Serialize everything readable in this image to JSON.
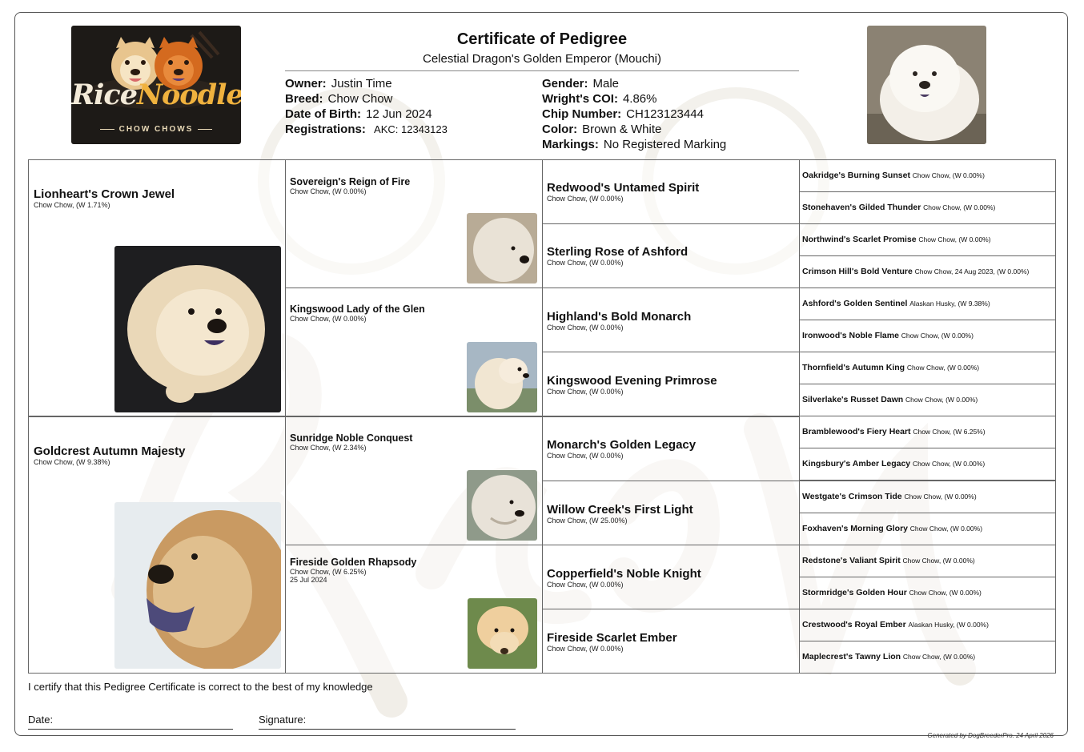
{
  "header": {
    "title": "Certificate of Pedigree",
    "subtitle": "Celestial Dragon's Golden Emperor (Mouchi)",
    "logo_word1": "Rice",
    "logo_word2": "Noodle",
    "logo_tagline": "CHOW CHOWS"
  },
  "info_left": [
    {
      "label": "Owner:",
      "value": "Justin Time"
    },
    {
      "label": "Breed:",
      "value": "Chow Chow"
    },
    {
      "label": "Date of Birth:",
      "value": "12 Jun 2024"
    },
    {
      "label": "Registrations:",
      "value": "AKC: 12343123"
    }
  ],
  "info_right": [
    {
      "label": "Gender:",
      "value": "Male"
    },
    {
      "label": "Wright's COI:",
      "value": "4.86%"
    },
    {
      "label": "Chip Number:",
      "value": "CH123123444"
    },
    {
      "label": "Color:",
      "value": "Brown & White"
    },
    {
      "label": "Markings:",
      "value": "No Registered Marking"
    }
  ],
  "gen1": [
    {
      "name": "Lionheart's Crown Jewel",
      "sub": "Chow Chow, (W 1.71%)"
    },
    {
      "name": "Goldcrest Autumn Majesty",
      "sub": "Chow Chow, (W 9.38%)"
    }
  ],
  "gen2": [
    {
      "name": "Sovereign's Reign of Fire",
      "sub": "Chow Chow, (W 0.00%)",
      "sub2": ""
    },
    {
      "name": "Kingswood Lady of the Glen",
      "sub": "Chow Chow, (W 0.00%)",
      "sub2": ""
    },
    {
      "name": "Sunridge Noble Conquest",
      "sub": "Chow Chow, (W 2.34%)",
      "sub2": ""
    },
    {
      "name": "Fireside Golden Rhapsody",
      "sub": "Chow Chow, (W 6.25%)",
      "sub2": "25 Jul 2024"
    }
  ],
  "gen3": [
    {
      "name": "Redwood's Untamed Spirit",
      "sub": "Chow Chow, (W 0.00%)"
    },
    {
      "name": "Sterling Rose of Ashford",
      "sub": "Chow Chow, (W 0.00%)"
    },
    {
      "name": "Highland's Bold Monarch",
      "sub": "Chow Chow, (W 0.00%)"
    },
    {
      "name": "Kingswood Evening Primrose",
      "sub": "Chow Chow, (W 0.00%)"
    },
    {
      "name": "Monarch's Golden Legacy",
      "sub": "Chow Chow, (W 0.00%)"
    },
    {
      "name": "Willow Creek's First Light",
      "sub": "Chow Chow, (W 25.00%)"
    },
    {
      "name": "Copperfield's Noble Knight",
      "sub": "Chow Chow, (W 0.00%)"
    },
    {
      "name": "Fireside Scarlet Ember",
      "sub": "Chow Chow, (W 0.00%)"
    }
  ],
  "gen4": [
    {
      "name": "Oakridge's Burning Sunset",
      "sub": "Chow Chow, (W 0.00%)"
    },
    {
      "name": "Stonehaven's Gilded Thunder",
      "sub": "Chow Chow, (W 0.00%)"
    },
    {
      "name": "Northwind's Scarlet Promise",
      "sub": "Chow Chow, (W 0.00%)"
    },
    {
      "name": "Crimson Hill's Bold Venture",
      "sub": "Chow Chow, 24 Aug 2023, (W 0.00%)"
    },
    {
      "name": "Ashford's Golden Sentinel",
      "sub": "Alaskan Husky, (W 9.38%)"
    },
    {
      "name": "Ironwood's Noble Flame",
      "sub": "Chow Chow, (W 0.00%)"
    },
    {
      "name": "Thornfield's Autumn King",
      "sub": "Chow Chow, (W 0.00%)"
    },
    {
      "name": "Silverlake's Russet Dawn",
      "sub": "Chow Chow, (W 0.00%)"
    },
    {
      "name": "Bramblewood's Fiery Heart",
      "sub": "Chow Chow, (W 6.25%)"
    },
    {
      "name": "Kingsbury's Amber Legacy",
      "sub": "Chow Chow, (W 0.00%)"
    },
    {
      "name": "Westgate's Crimson Tide",
      "sub": "Chow Chow, (W 0.00%)"
    },
    {
      "name": "Foxhaven's Morning Glory",
      "sub": "Chow Chow, (W 0.00%)"
    },
    {
      "name": "Redstone's Valiant Spirit",
      "sub": "Chow Chow, (W 0.00%)"
    },
    {
      "name": "Stormridge's Golden Hour",
      "sub": "Chow Chow, (W 0.00%)"
    },
    {
      "name": "Crestwood's Royal Ember",
      "sub": "Alaskan Husky, (W 0.00%)"
    },
    {
      "name": "Maplecrest's Tawny Lion",
      "sub": "Chow Chow, (W 0.00%)"
    }
  ],
  "footer": {
    "certify": "I certify that this Pedigree Certificate is correct to the best of my knowledge",
    "date_label": "Date:",
    "signature_label": "Signature:",
    "generated": "Generated by DogBreederPro.  24 April 2026"
  },
  "colors": {
    "border": "#666666",
    "logo_bg": "#1d1a17",
    "logo_accent": "#f0b23e",
    "watermark": "#f2efe9"
  }
}
